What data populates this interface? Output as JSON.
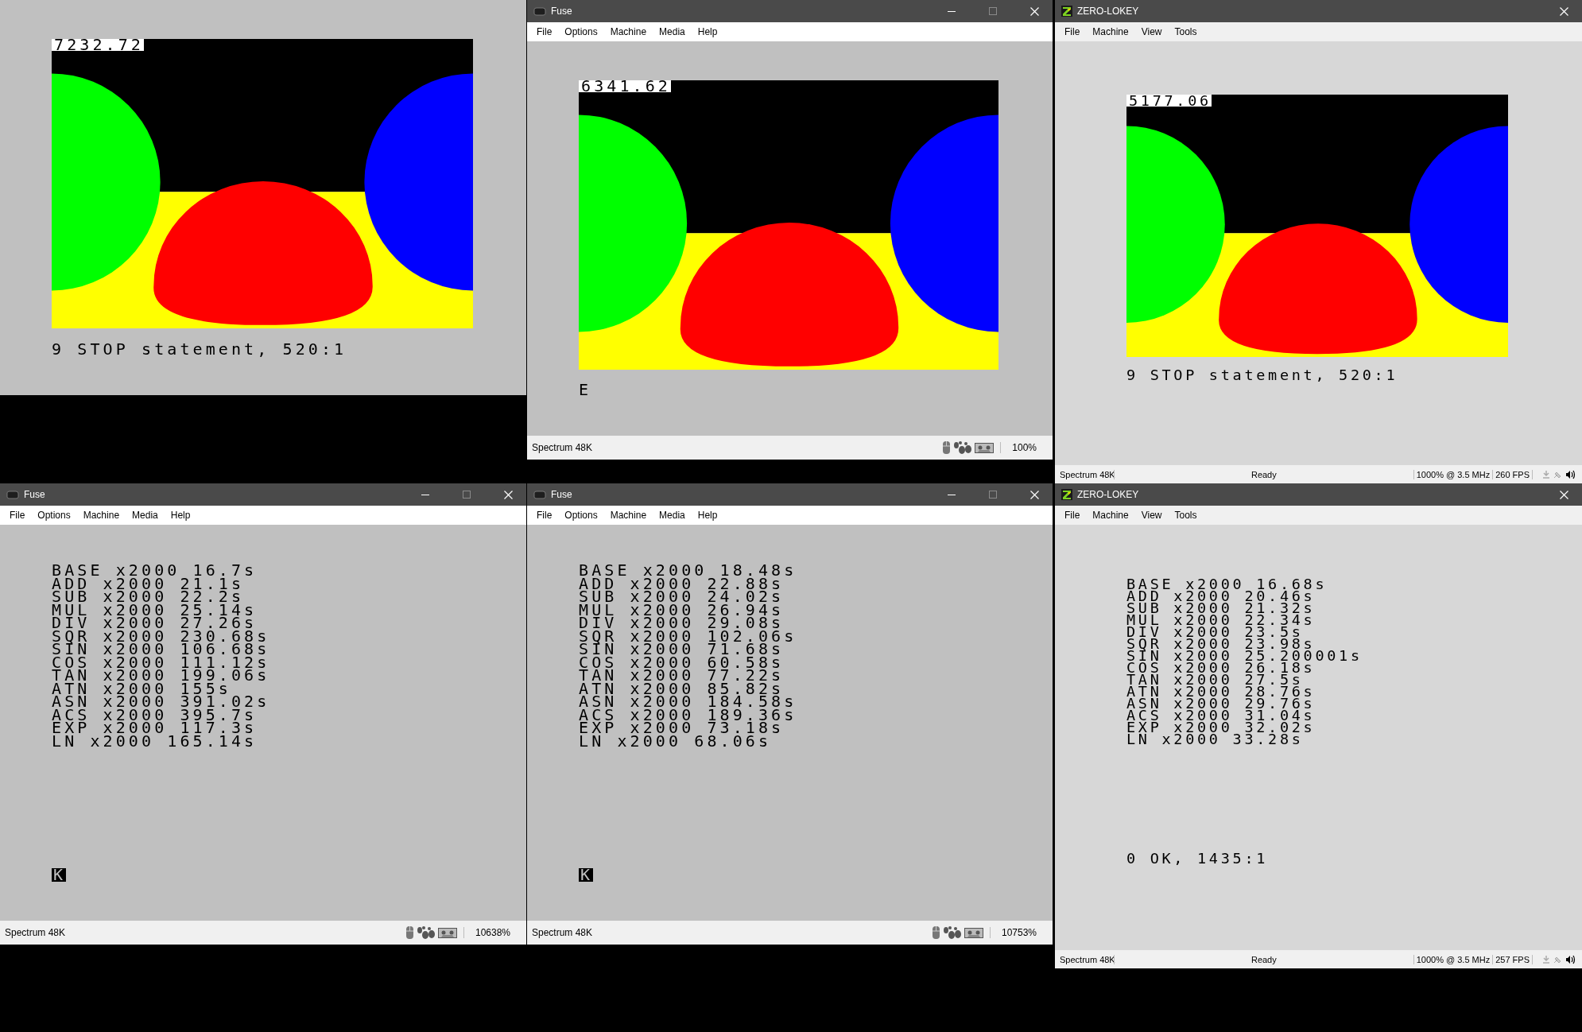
{
  "windows": [
    {
      "kind": "bare",
      "screen": {
        "counter": "7232.72"
      },
      "message": "9 STOP statement, 520:1"
    },
    {
      "kind": "fuse",
      "title": "Fuse",
      "menu": [
        "File",
        "Options",
        "Machine",
        "Media",
        "Help"
      ],
      "screen": {
        "counter": "6341.62"
      },
      "message": "E",
      "status": {
        "machine": "Spectrum 48K",
        "speed": "100%"
      }
    },
    {
      "kind": "zero",
      "title": "ZERO-LOKEY",
      "menu": [
        "File",
        "Machine",
        "View",
        "Tools"
      ],
      "screen": {
        "counter": "5177.06"
      },
      "message": "9 STOP statement, 520:1",
      "status": {
        "machine": "Spectrum 48K",
        "state": "Ready",
        "speed": "1000% @ 3.5 MHz",
        "fps": "260 FPS"
      }
    },
    {
      "kind": "fuse",
      "title": "Fuse",
      "menu": [
        "File",
        "Options",
        "Machine",
        "Media",
        "Help"
      ],
      "lines": [
        "BASE x2000 16.7s",
        "ADD x2000 21.1s",
        "SUB x2000 22.2s",
        "MUL x2000 25.14s",
        "DIV x2000 27.26s",
        "SQR x2000 230.68s",
        "SIN x2000 106.68s",
        "COS x2000 111.12s",
        "TAN x2000 199.06s",
        "ATN x2000 155s",
        "ASN x2000 391.02s",
        "ACS x2000 395.7s",
        "EXP x2000 117.3s",
        "LN x2000 165.14s"
      ],
      "cursor": "K",
      "status": {
        "machine": "Spectrum 48K",
        "speed": "10638%"
      }
    },
    {
      "kind": "fuse",
      "title": "Fuse",
      "menu": [
        "File",
        "Options",
        "Machine",
        "Media",
        "Help"
      ],
      "lines": [
        "BASE x2000 18.48s",
        "ADD x2000 22.88s",
        "SUB x2000 24.02s",
        "MUL x2000 26.94s",
        "DIV x2000 29.08s",
        "SQR x2000 102.06s",
        "SIN x2000 71.68s",
        "COS x2000 60.58s",
        "TAN x2000 77.22s",
        "ATN x2000 85.82s",
        "ASN x2000 184.58s",
        "ACS x2000 189.36s",
        "EXP x2000 73.18s",
        "LN x2000 68.06s"
      ],
      "cursor": "K",
      "status": {
        "machine": "Spectrum 48K",
        "speed": "10753%"
      }
    },
    {
      "kind": "zero",
      "title": "ZERO-LOKEY",
      "menu": [
        "File",
        "Machine",
        "View",
        "Tools"
      ],
      "lines": [
        "BASE x2000 16.68s",
        "ADD x2000 20.46s",
        "SUB x2000 21.32s",
        "MUL x2000 22.34s",
        "DIV x2000 23.5s",
        "SQR x2000 23.98s",
        "SIN x2000 25.200001s",
        "COS x2000 26.18s",
        "TAN x2000 27.5s",
        "ATN x2000 28.76s",
        "ASN x2000 29.76s",
        "ACS x2000 31.04s",
        "EXP x2000 32.02s",
        "LN x2000 33.28s"
      ],
      "message": "0 OK, 1435:1",
      "status": {
        "machine": "Spectrum 48K",
        "state": "Ready",
        "speed": "1000% @ 3.5 MHz",
        "fps": "257 FPS"
      }
    }
  ]
}
